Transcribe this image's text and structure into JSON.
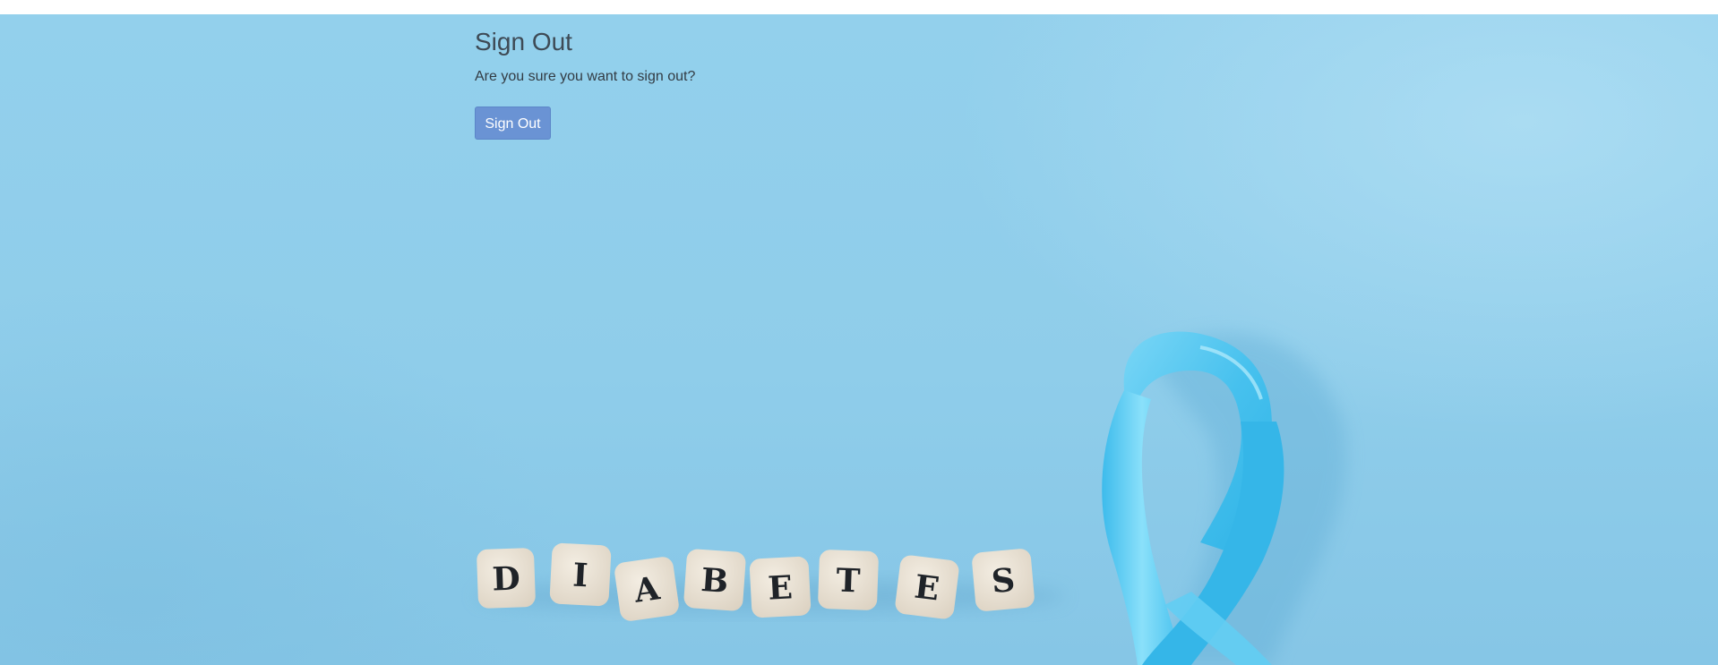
{
  "page": {
    "title": "Sign Out",
    "message": "Are you sure you want to sign out?",
    "sign_out_button_label": "Sign Out"
  },
  "background_image": {
    "description_icon": "diabetes-awareness-photo",
    "cube_letters": [
      "D",
      "I",
      "A",
      "B",
      "E",
      "T",
      "E",
      "S"
    ],
    "ribbon_color": "#4cc3ee",
    "background_color": "#8fcdea"
  },
  "colors": {
    "button_bg": "#6a93d4",
    "button_text": "#ffffff",
    "title_text": "#3e4a55"
  }
}
